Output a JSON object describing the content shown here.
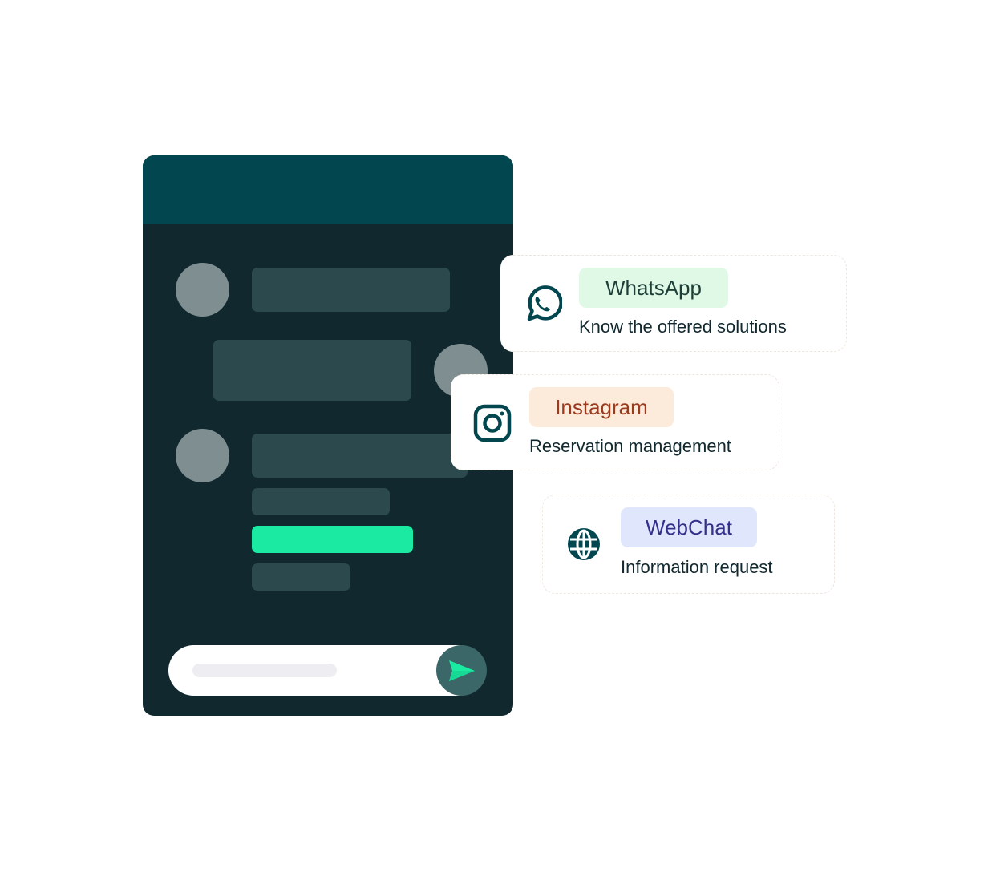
{
  "colors": {
    "phone_header": "#02474f",
    "phone_body": "#10282e",
    "bubble": "#2c4a4d",
    "accent_bubble": "#1beba2",
    "avatar": "#7f8f91",
    "send_button": "#3c6769",
    "icon": "#02474f"
  },
  "chat": {
    "input_placeholder": "",
    "send_icon": "send-arrow-icon"
  },
  "channels": [
    {
      "name": "WhatsApp",
      "description": "Know the offered solutions",
      "icon": "whatsapp-icon",
      "tag_bg": "#e0f9e6",
      "tag_color": "#1e3f37"
    },
    {
      "name": "Instagram",
      "description": "Reservation management",
      "icon": "instagram-icon",
      "tag_bg": "#fcebda",
      "tag_color": "#9a3b1f"
    },
    {
      "name": "WebChat",
      "description": "Information request",
      "icon": "globe-icon",
      "tag_bg": "#e0e6fb",
      "tag_color": "#33318a"
    }
  ]
}
